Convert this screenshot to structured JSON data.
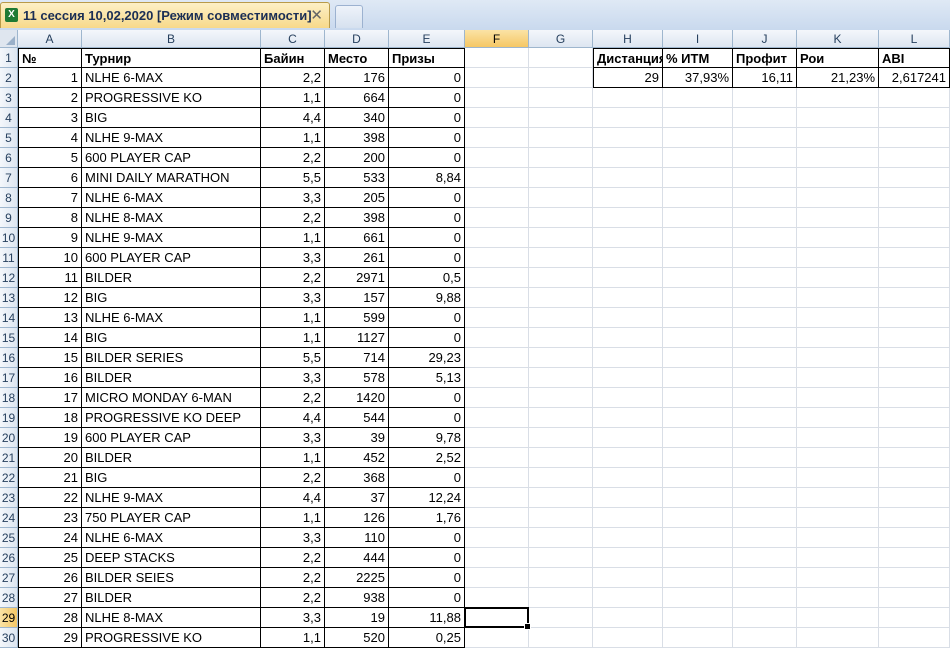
{
  "tab": {
    "title": "11 сессия 10,02,2020  [Режим совместимости]",
    "close_glyph": "✕",
    "icon": "excel-file-icon",
    "icon_glyph": "X"
  },
  "columns": [
    "A",
    "B",
    "C",
    "D",
    "E",
    "F",
    "G",
    "H",
    "I",
    "J",
    "K",
    "L"
  ],
  "selected_column": "F",
  "selected_row": 29,
  "row_numbers": [
    1,
    2,
    3,
    4,
    5,
    6,
    7,
    8,
    9,
    10,
    11,
    12,
    13,
    14,
    15,
    16,
    17,
    18,
    19,
    20,
    21,
    22,
    23,
    24,
    25,
    26,
    27,
    28,
    29,
    30
  ],
  "table": {
    "headers": [
      "№",
      "Турнир",
      "Байин",
      "Место",
      "Призы"
    ],
    "rows": [
      [
        "1",
        "NLHE 6-MAX",
        "2,2",
        "176",
        "0"
      ],
      [
        "2",
        "PROGRESSIVE KO",
        "1,1",
        "664",
        "0"
      ],
      [
        "3",
        "BIG",
        "4,4",
        "340",
        "0"
      ],
      [
        "4",
        "NLHE 9-MAX",
        "1,1",
        "398",
        "0"
      ],
      [
        "5",
        "600 PLAYER CAP",
        "2,2",
        "200",
        "0"
      ],
      [
        "6",
        "MINI DAILY MARATHON",
        "5,5",
        "533",
        "8,84"
      ],
      [
        "7",
        "NLHE 6-MAX",
        "3,3",
        "205",
        "0"
      ],
      [
        "8",
        "NLHE 8-MAX",
        "2,2",
        "398",
        "0"
      ],
      [
        "9",
        "NLHE 9-MAX",
        "1,1",
        "661",
        "0"
      ],
      [
        "10",
        "600 PLAYER CAP",
        "3,3",
        "261",
        "0"
      ],
      [
        "11",
        "BILDER",
        "2,2",
        "2971",
        "0,5"
      ],
      [
        "12",
        "BIG",
        "3,3",
        "157",
        "9,88"
      ],
      [
        "13",
        "NLHE 6-MAX",
        "1,1",
        "599",
        "0"
      ],
      [
        "14",
        "BIG",
        "1,1",
        "1127",
        "0"
      ],
      [
        "15",
        "BILDER SERIES",
        "5,5",
        "714",
        "29,23"
      ],
      [
        "16",
        "BILDER",
        "3,3",
        "578",
        "5,13"
      ],
      [
        "17",
        "MICRO MONDAY 6-MAN",
        "2,2",
        "1420",
        "0"
      ],
      [
        "18",
        "PROGRESSIVE KO DEEP",
        "4,4",
        "544",
        "0"
      ],
      [
        "19",
        "600 PLAYER CAP",
        "3,3",
        "39",
        "9,78"
      ],
      [
        "20",
        "BILDER",
        "1,1",
        "452",
        "2,52"
      ],
      [
        "21",
        "BIG",
        "2,2",
        "368",
        "0"
      ],
      [
        "22",
        "NLHE 9-MAX",
        "4,4",
        "37",
        "12,24"
      ],
      [
        "23",
        "750 PLAYER CAP",
        "1,1",
        "126",
        "1,76"
      ],
      [
        "24",
        "NLHE 6-MAX",
        "3,3",
        "110",
        "0"
      ],
      [
        "25",
        "DEEP STACKS",
        "2,2",
        "444",
        "0"
      ],
      [
        "26",
        "BILDER SEIES",
        "2,2",
        "2225",
        "0"
      ],
      [
        "27",
        "BILDER",
        "2,2",
        "938",
        "0"
      ],
      [
        "28",
        "NLHE 8-MAX",
        "3,3",
        "19",
        "11,88"
      ],
      [
        "29",
        "PROGRESSIVE KO",
        "1,1",
        "520",
        "0,25"
      ]
    ]
  },
  "summary": {
    "headers": [
      "Дистанция",
      "% ИТМ",
      "Профит",
      "Рои",
      "ABI"
    ],
    "values": [
      "29",
      "37,93%",
      "16,11",
      "21,23%",
      "2,617241"
    ]
  }
}
